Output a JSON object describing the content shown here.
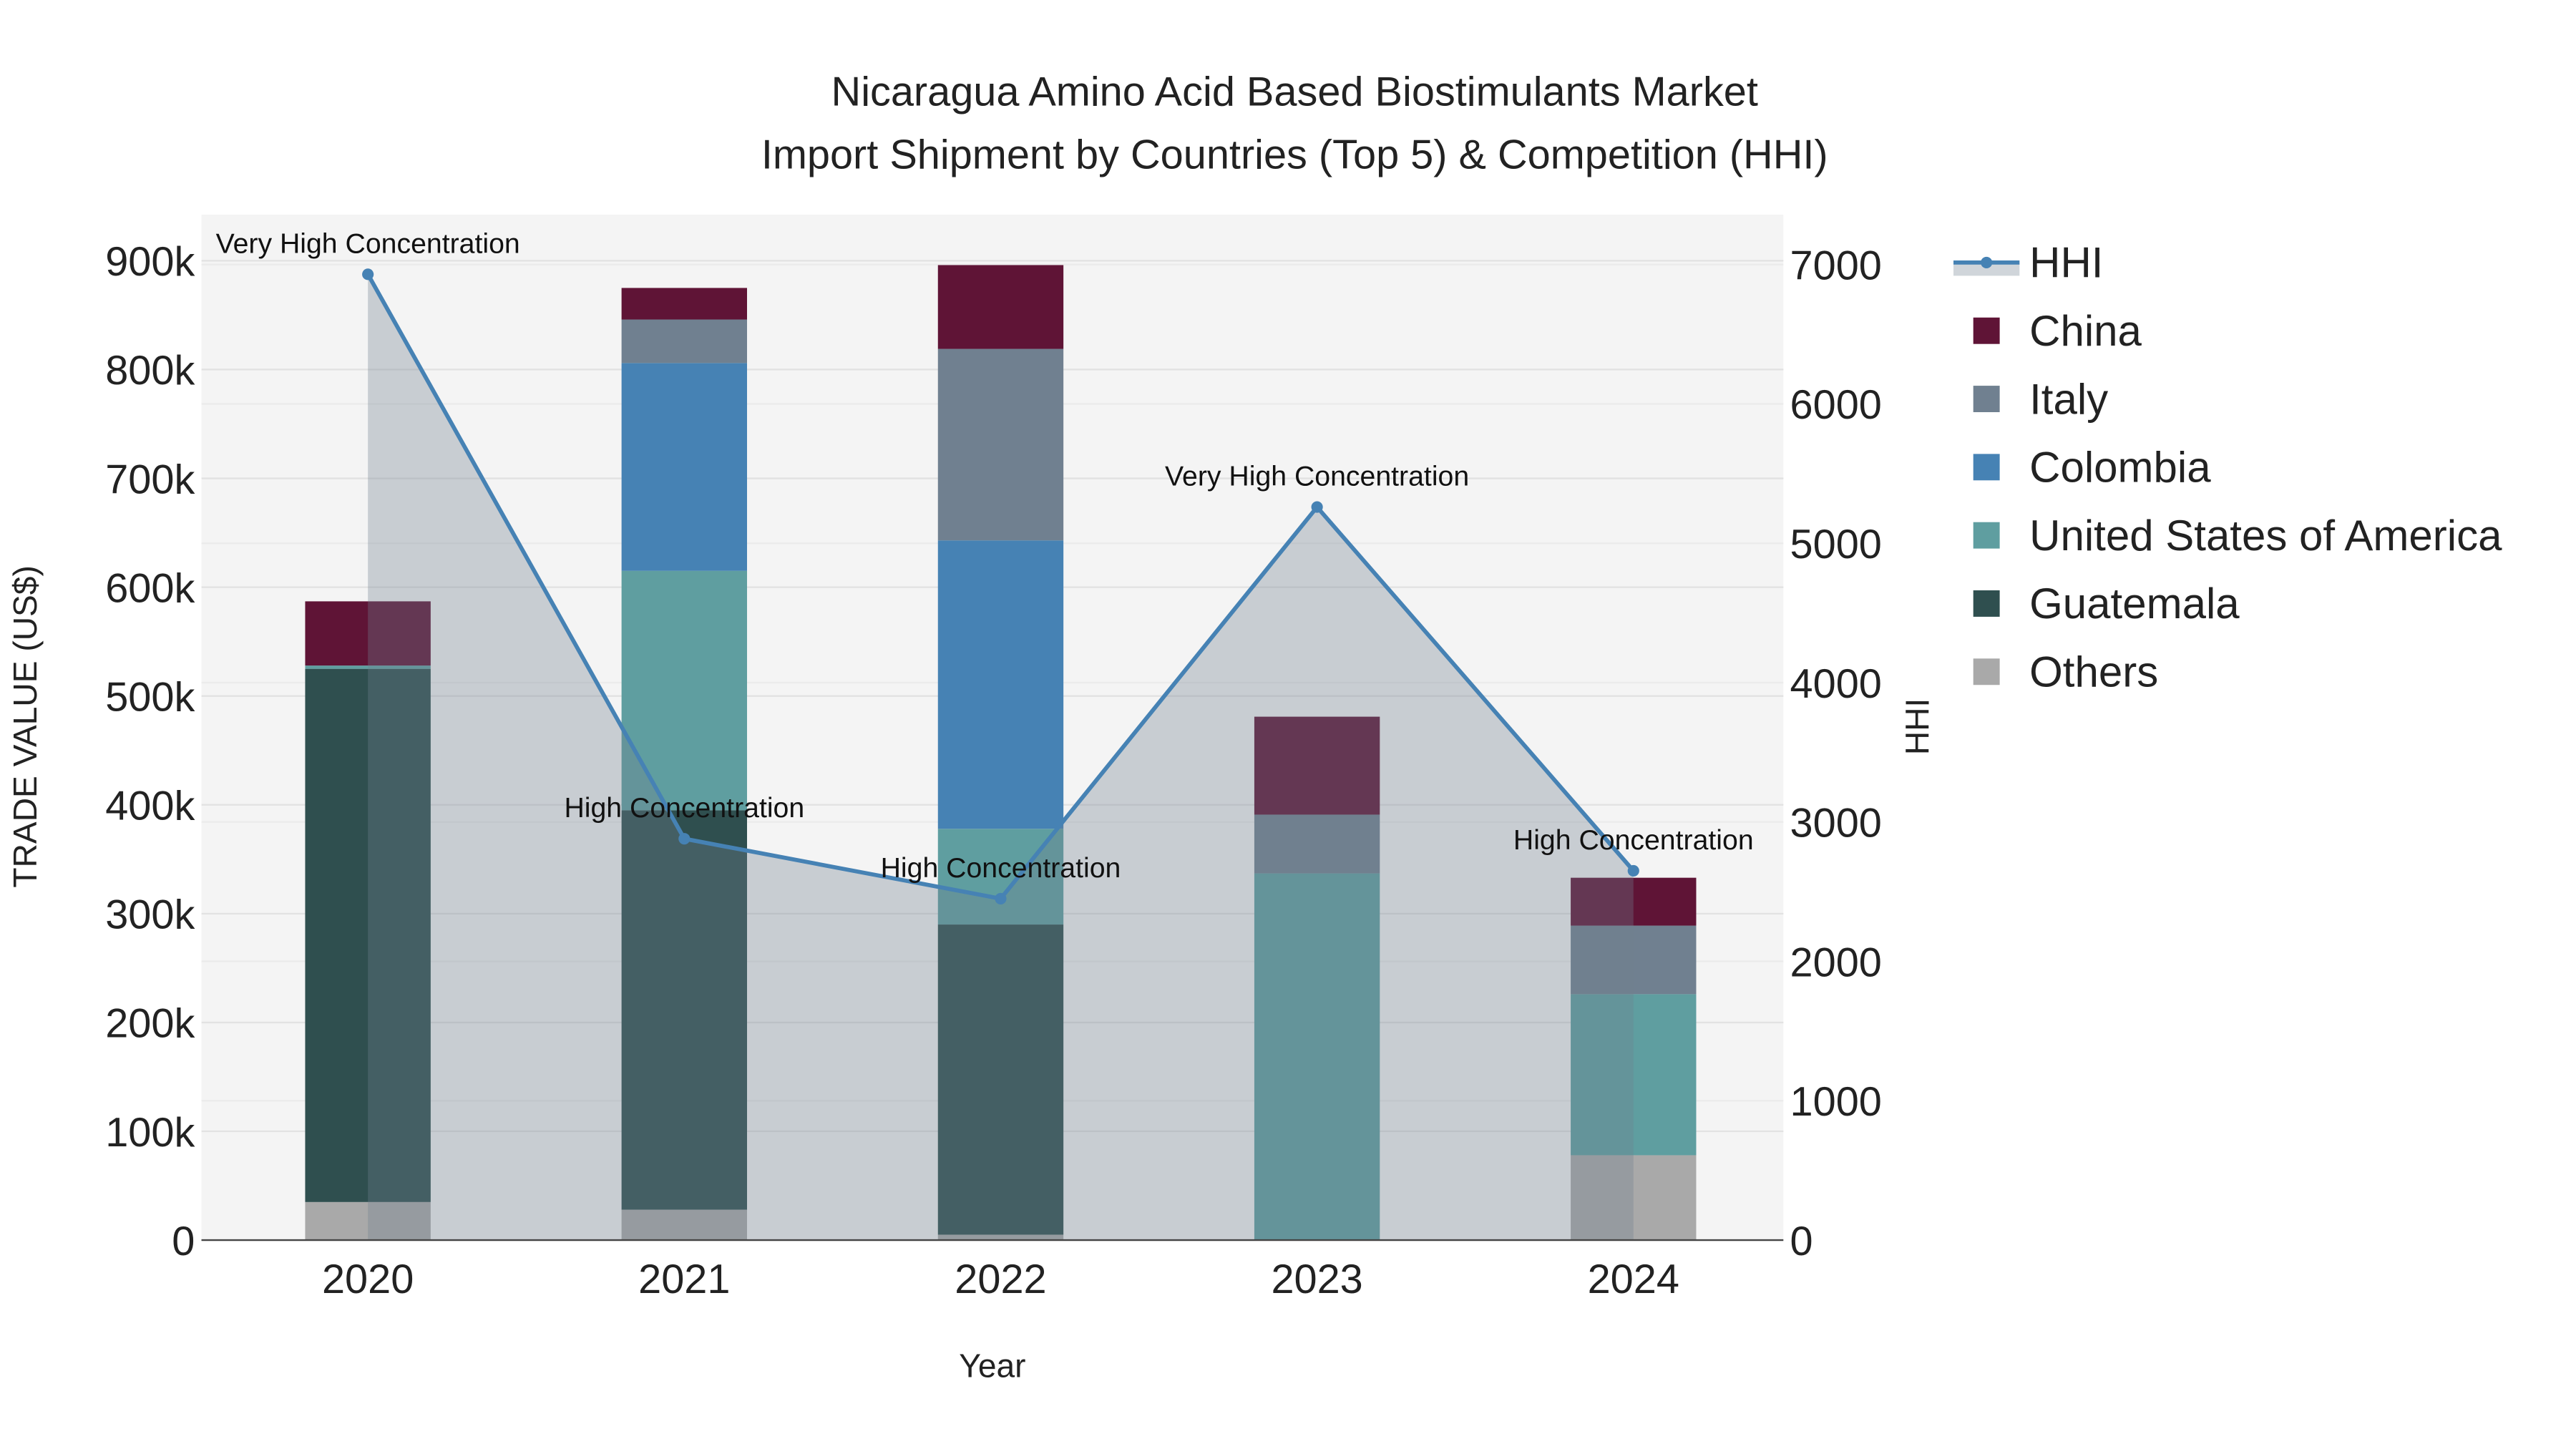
{
  "chart_data": {
    "type": "bar",
    "stacked": true,
    "title_line1": "Nicaragua Amino Acid Based Biostimulants Market",
    "title_line2": "Import Shipment by Countries (Top 5) & Competition (HHI)",
    "xlabel": "Year",
    "ylabel": "TRADE VALUE (US$)",
    "y2label": "HHI",
    "categories": [
      "2020",
      "2021",
      "2022",
      "2023",
      "2024"
    ],
    "ylim": [
      0,
      940000
    ],
    "y_ticks": [
      0,
      100000,
      200000,
      300000,
      400000,
      500000,
      600000,
      700000,
      800000,
      900000
    ],
    "y_tick_labels": [
      "0",
      "100k",
      "200k",
      "300k",
      "400k",
      "500k",
      "600k",
      "700k",
      "800k",
      "900k"
    ],
    "y2lim": [
      0,
      7350
    ],
    "y2_ticks": [
      0,
      1000,
      2000,
      3000,
      4000,
      5000,
      6000,
      7000
    ],
    "y2_tick_labels": [
      "0",
      "1000",
      "2000",
      "3000",
      "4000",
      "5000",
      "6000",
      "7000"
    ],
    "grid": true,
    "legend_placement": "right",
    "series": [
      {
        "name": "Others",
        "color": "#a9a9a9",
        "values": [
          35000,
          28000,
          5000,
          0,
          78000
        ]
      },
      {
        "name": "Guatemala",
        "color": "#2f4f4f",
        "values": [
          490000,
          367000,
          285000,
          0,
          0
        ]
      },
      {
        "name": "United States of America",
        "color": "#5f9ea0",
        "values": [
          3000,
          220000,
          88000,
          337000,
          148000
        ]
      },
      {
        "name": "Colombia",
        "color": "#4682b4",
        "values": [
          0,
          191000,
          265000,
          0,
          0
        ]
      },
      {
        "name": "Italy",
        "color": "#708090",
        "values": [
          0,
          40000,
          176000,
          54000,
          63000
        ]
      },
      {
        "name": "China",
        "color": "#5f1436",
        "values": [
          59000,
          29000,
          77000,
          90000,
          44000
        ]
      }
    ],
    "line": {
      "name": "HHI",
      "color": "#4682b4",
      "fill": "rgba(112,128,144,0.33)",
      "values": [
        6930,
        2880,
        2450,
        5260,
        2650
      ],
      "annotations": [
        "Very High Concentration",
        "High Concentration",
        "High Concentration",
        "Very High Concentration",
        "High Concentration"
      ]
    },
    "legend_order": [
      "HHI",
      "China",
      "Italy",
      "Colombia",
      "United States of America",
      "Guatemala",
      "Others"
    ]
  }
}
